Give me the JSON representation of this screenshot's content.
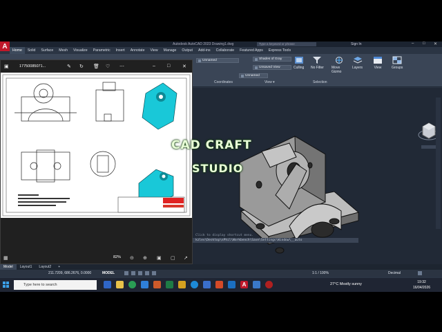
{
  "titlebar": {
    "app_title": "Autodesk AutoCAD 2023   Drawing1.dwg",
    "search_placeholder": "Type a keyword or phrase",
    "sign_in": "Sign In"
  },
  "ribbon_tabs": [
    "Home",
    "Solid",
    "Surface",
    "Mesh",
    "Visualize",
    "Parametric",
    "Insert",
    "Annotate",
    "View",
    "Manage",
    "Output",
    "Add-ins",
    "Collaborate",
    "Featured Apps",
    "Express Tools"
  ],
  "ribbon": {
    "visual_style": "Shades of Gray",
    "view_dropdown": "Unsaved View",
    "ucs_dropdown": "Unnamed",
    "culling": "Culling",
    "no_filter": "No Filter",
    "move_gizmo": "Move Gizmo",
    "layers": "Layers",
    "view": "View",
    "groups": "Groups",
    "panel_coordinates": "Coordinates",
    "panel_view": "View ▾",
    "panel_selection": "Selection"
  },
  "viewer": {
    "file_name": "17750085071...",
    "zoom": "82%"
  },
  "command_line": {
    "hint": "Click to display shortcut menu.",
    "history": "kzlev\\Desktop\\nPhil\\Workbench\\Save\\Settings\\Window\\__auto"
  },
  "layout_tabs": [
    "Model",
    "Layout1",
    "Layout2",
    "+"
  ],
  "status": {
    "coords": "211.7209, 686.2676, 0.0000",
    "space": "MODEL",
    "scale": "1:1 / 100%",
    "units": "Decimal"
  },
  "taskbar": {
    "search_placeholder": "Type here to search",
    "weather": "27°C  Mostly sunny",
    "time": "19:32",
    "date": "16/04/2026"
  },
  "watermark": {
    "line1": "CAD CRAFT",
    "line2": "STUDIO"
  },
  "colors": {
    "accent": "#c0182a",
    "model_bg": "#212936",
    "part_cyan": "#19c8d8"
  }
}
